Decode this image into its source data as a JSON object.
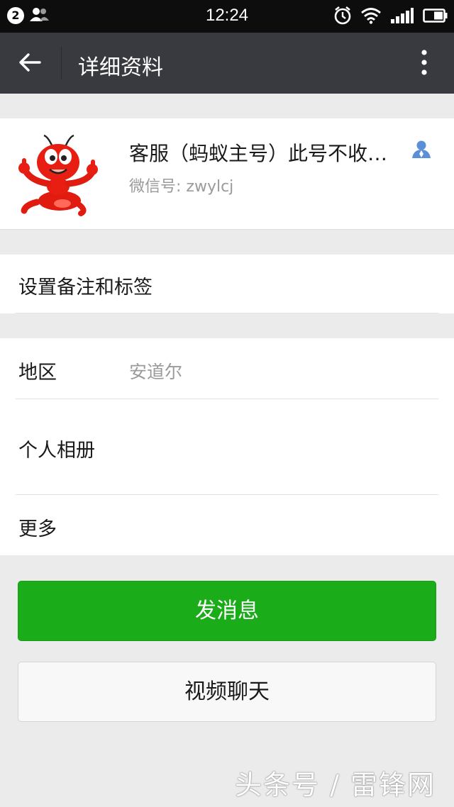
{
  "status_bar": {
    "badge": "2",
    "time": "12:24",
    "icons": [
      "people-icon",
      "alarm-icon",
      "wifi-icon",
      "signal-icon",
      "battery-icon"
    ]
  },
  "appbar": {
    "title": "详细资料",
    "back_icon": "back-arrow-icon",
    "more_icon": "more-vertical-icon",
    "background": "#393a3f"
  },
  "profile": {
    "name": "客服（蚂蚁主号）此号不收…",
    "wechat_id": "微信号: zwylcj",
    "avatar": "red-ant-mascot",
    "contact_icon": "contact-person-icon"
  },
  "remark_row": {
    "label": "设置备注和标签"
  },
  "info_rows": [
    {
      "label": "地区",
      "value": "安道尔"
    },
    {
      "label": "个人相册",
      "value": ""
    },
    {
      "label": "更多",
      "value": ""
    }
  ],
  "buttons": {
    "send_message": "发消息",
    "video_chat": "视频聊天"
  },
  "watermark": "头条号 / 雷锋网",
  "colors": {
    "primary_green": "#1aad19",
    "page_bg": "#ebebeb",
    "contact_icon_blue": "#5b8fd6"
  }
}
